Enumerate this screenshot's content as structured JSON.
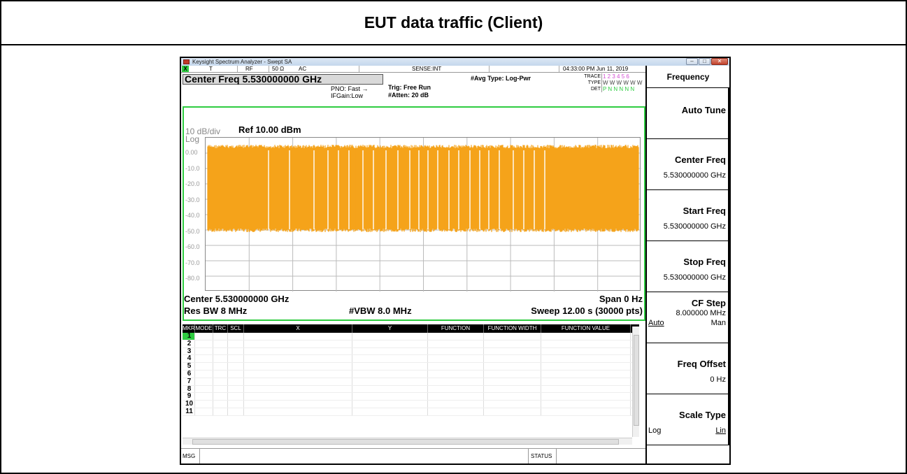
{
  "report": {
    "title": "EUT data traffic (Client)"
  },
  "window": {
    "title": "Keysight Spectrum Analyzer - Swept SA",
    "buttons": [
      "–",
      "□",
      "✕"
    ]
  },
  "status": {
    "mode": "T",
    "rf": "RF",
    "impedance": "50 Ω",
    "coupling": "AC",
    "sense": "SENSE:INT",
    "datetime": "04:33:00 PM Jun 11, 2019"
  },
  "header": {
    "center_freq": "Center Freq 5.530000000 GHz",
    "pno": "PNO: Fast",
    "ifgain": "IFGain:Low",
    "trig": "Trig: Free Run",
    "atten": "#Atten: 20 dB",
    "avg_type": "#Avg Type: Log-Pwr",
    "trace_labels": [
      "TRACE",
      "TYPE",
      "DET"
    ],
    "trace_values": [
      "1 2 3 4 5 6",
      "W W W W W W",
      "P N N N N N"
    ]
  },
  "graph": {
    "scale": "10 dB/div",
    "ref": "Ref 10.00 dBm",
    "log": "Log",
    "yticks": [
      "0.00",
      "-10.0",
      "-20.0",
      "-30.0",
      "-40.0",
      "-50.0",
      "-60.0",
      "-70.0",
      "-80.0"
    ],
    "center": "Center 5.530000000 GHz",
    "span": "Span 0 Hz",
    "res_bw": "Res BW 8 MHz",
    "vbw": "#VBW 8.0 MHz",
    "sweep": "Sweep  12.00 s (30000 pts)",
    "trace_color": "#f5a31a",
    "border_color": "#2ecc40"
  },
  "marker_table": {
    "headers": [
      "MKR",
      "MODE",
      "TRC",
      "SCL",
      "X",
      "Y",
      "FUNCTION",
      "FUNCTION WIDTH",
      "FUNCTION VALUE"
    ],
    "rows": [
      "1",
      "2",
      "3",
      "4",
      "5",
      "6",
      "7",
      "8",
      "9",
      "10",
      "11"
    ]
  },
  "msgbar": {
    "msg": "MSG",
    "status": "STATUS"
  },
  "softkeys": {
    "title": "Frequency",
    "auto_tune": "Auto Tune",
    "center_freq_label": "Center Freq",
    "center_freq_value": "5.530000000 GHz",
    "start_freq_label": "Start Freq",
    "start_freq_value": "5.530000000 GHz",
    "stop_freq_label": "Stop Freq",
    "stop_freq_value": "5.530000000 GHz",
    "cf_step_label": "CF Step",
    "cf_step_value": "8.000000 MHz",
    "cf_step_auto": "Auto",
    "cf_step_man": "Man",
    "freq_offset_label": "Freq Offset",
    "freq_offset_value": "0 Hz",
    "scale_type_label": "Scale Type",
    "scale_type_log": "Log",
    "scale_type_lin": "Lin"
  }
}
